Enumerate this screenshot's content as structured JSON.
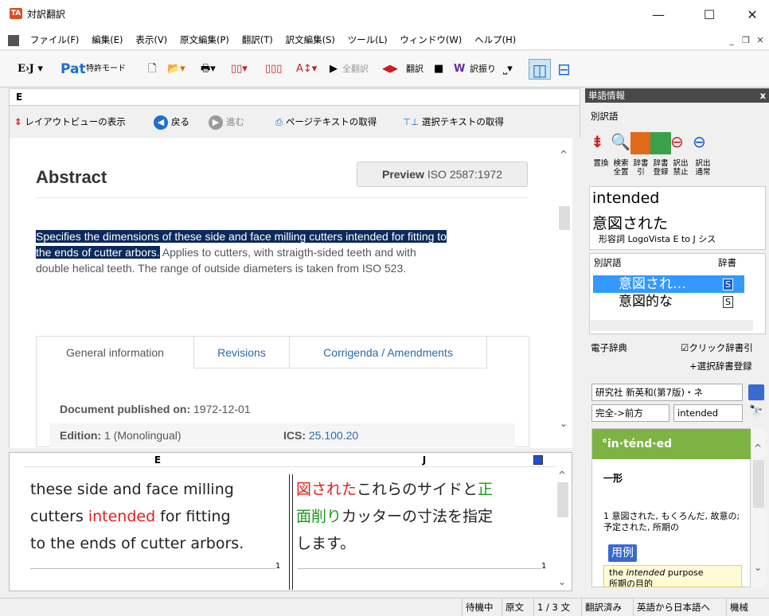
{
  "titlebar": {
    "title": "対訳翻訳",
    "min": "—",
    "max": "☐",
    "close": "✕"
  },
  "menubar": {
    "items": [
      "ファイル(F)",
      "編集(E)",
      "表示(V)",
      "原文編集(P)",
      "翻訳(T)",
      "訳文編集(S)",
      "ツール(L)",
      "ウィンドウ(W)",
      "ヘルプ(H)"
    ]
  },
  "toolbar": {
    "ej": "E›J",
    "pat": "Pat",
    "patent_mode": "特許モード",
    "all_translate": "全翻訳",
    "translate": "翻訳",
    "furigana": "訳振り"
  },
  "editor": {
    "header": "E",
    "layout_view": "レイアウトビューの表示",
    "back": "戻る",
    "forward": "進む",
    "get_page_text": "ページテキストの取得",
    "get_selected_text": "選択テキストの取得"
  },
  "web": {
    "abstract_title": "Abstract",
    "preview_label": "Preview",
    "preview_doc": "ISO 2587:1972",
    "para_highlighted_1": "Specifies the dimensions of these side and face milling cutters intended for fitting to",
    "para_highlighted_2": "the ends of cutter arbors.",
    "para_rest_1": " Applies to cutters, with straigth-sided teeth and with",
    "para_rest_2": "double helical teeth. The range of outside diameters is taken from ISO 523.",
    "tabs": [
      "General information",
      "Revisions",
      "Corrigenda / Amendments"
    ],
    "published_label": "Document published on:",
    "published_value": "1972-12-01",
    "edition_label": "Edition:",
    "edition_value": "1 (Monolingual)",
    "ics_label": "ICS:",
    "ics_value": "25.100.20"
  },
  "bilingual": {
    "e_header": "E",
    "j_header": "J",
    "e_line1": "these side and face milling",
    "e_line2a": "cutters ",
    "e_line2b": "intended",
    "e_line2c": " for fitting",
    "e_line3": "to the ends of cutter arbors.",
    "j_line1a": "図された",
    "j_line1b": "これらのサイドと",
    "j_line1c": "正",
    "j_line2a": "面削り",
    "j_line2b": "カッターの寸法を指定",
    "j_line3": "します。",
    "e_index": "1",
    "j_index": "1"
  },
  "wordinfo": {
    "header": "単語情報",
    "close": "x",
    "alt_header": "別訳語",
    "buttons": [
      "置換",
      "検索 全置",
      "辞書引",
      "辞書 登録",
      "訳出 禁止",
      "訳出 通常"
    ],
    "word": "intended",
    "meaning": "意図された",
    "pos_dict": "形容詞 LogoVista E to J シス",
    "list_col1": "別訳語",
    "list_col2": "辞書",
    "list_items": [
      "意図され…",
      "意図的な"
    ],
    "list_marks": [
      "S",
      "S"
    ]
  },
  "dict": {
    "header": "電子辞典",
    "click_dict": "クリック辞書引",
    "select_register": "+選択辞書登録",
    "dict_name": "研究社 新英和(第7版)・ネ",
    "match_mode": "完全->前方",
    "query": "intended",
    "headword": "°in·ténd·ed",
    "pos_mark": "一形",
    "definition": "1 意図された, もくろんだ, 故意の; 予定された, 所期の",
    "example_btn": "用例",
    "example_text_pre": "the ",
    "example_text_em": "intended",
    "example_text_post": " purpose",
    "example_jp": "所期の目的"
  },
  "status": {
    "items": [
      "待機中",
      "原文",
      "1 / 3 文",
      "翻訳済み",
      "英語から日本語へ",
      "機械"
    ]
  },
  "colors": {
    "highlight": "#0b2a5c",
    "red": "#e02020",
    "green": "#1a9a1a",
    "dict_green": "#7cb342",
    "selection_blue": "#3399ff"
  }
}
